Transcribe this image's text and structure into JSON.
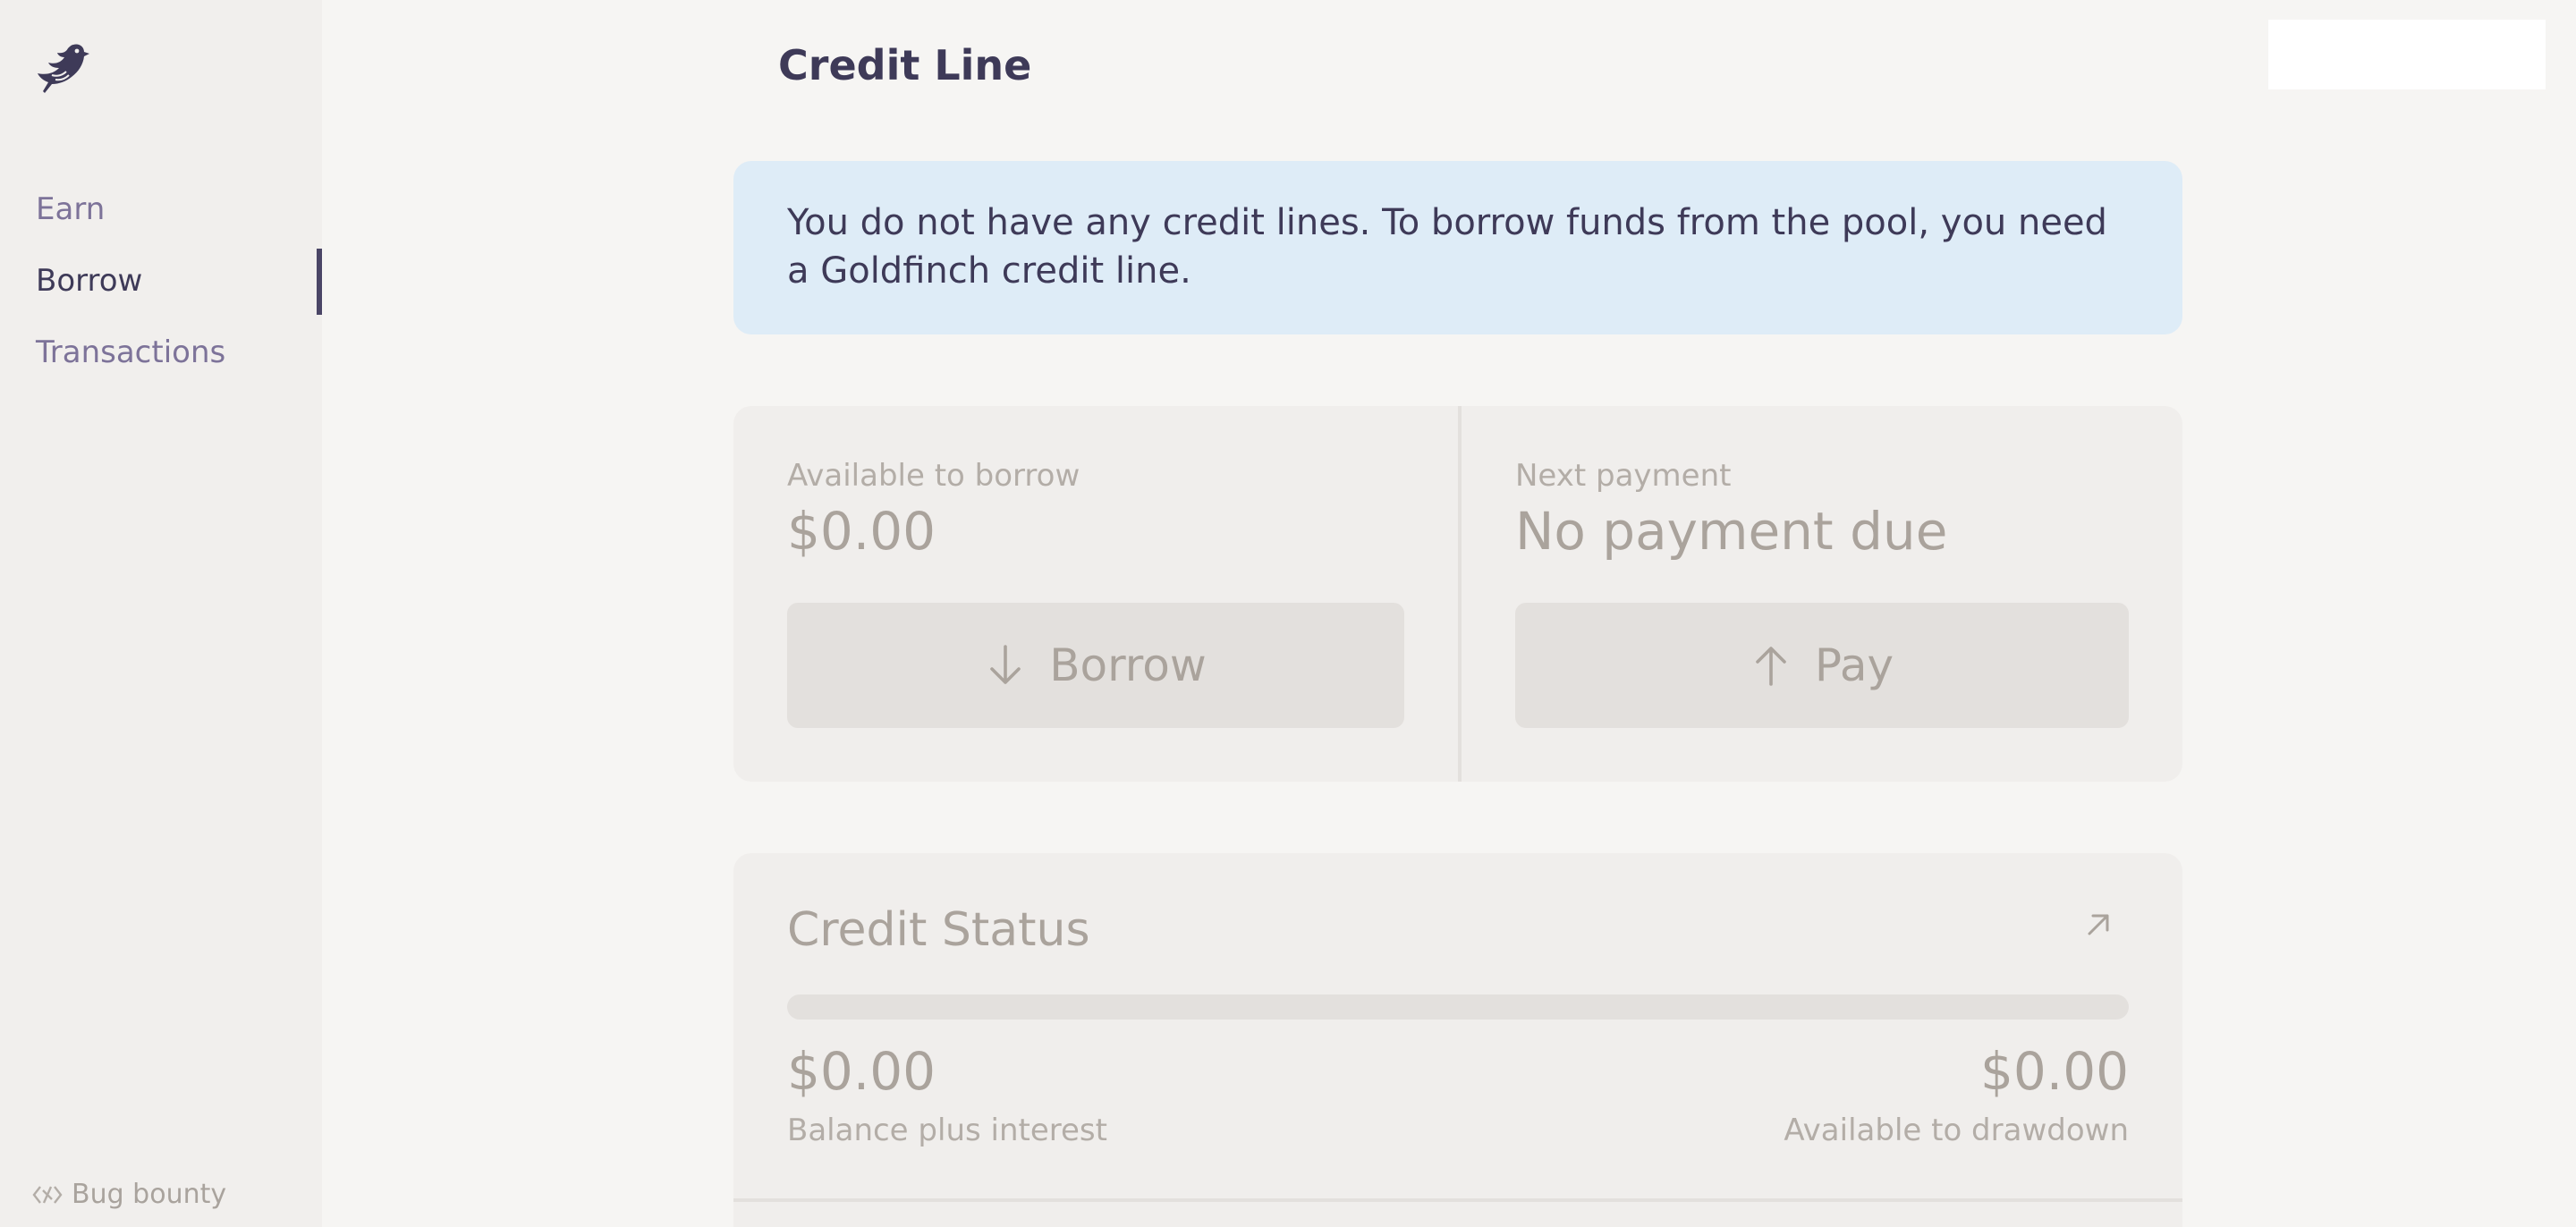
{
  "sidebar": {
    "logo_icon": "goldfinch-bird-logo",
    "items": [
      {
        "label": "Earn",
        "active": false
      },
      {
        "label": "Borrow",
        "active": true
      },
      {
        "label": "Transactions",
        "active": false
      }
    ],
    "footer_link": {
      "label": "Bug bounty",
      "icon": "bug-bounty-icon"
    }
  },
  "header": {
    "title": "Credit Line"
  },
  "banner": {
    "message": "You do not have any credit lines. To borrow funds from the pool, you need a Goldfinch credit line."
  },
  "actions": {
    "borrow": {
      "label": "Available to borrow",
      "value": "$0.00",
      "button_label": "Borrow",
      "button_icon": "arrow-down-icon"
    },
    "pay": {
      "label": "Next payment",
      "value": "No payment due",
      "button_label": "Pay",
      "button_icon": "arrow-up-icon"
    }
  },
  "credit_status": {
    "title": "Credit Status",
    "expand_icon": "arrow-up-right-icon",
    "progress": 0,
    "balance": {
      "value": "$0.00",
      "label": "Balance plus interest"
    },
    "available": {
      "value": "$0.00",
      "label": "Available to drawdown"
    }
  },
  "colors": {
    "accent": "#3e3a58",
    "nav_inactive": "#7d7399",
    "banner_bg": "#deecf7",
    "panel_bg": "#f0eeec",
    "disabled_text": "#aaa39c"
  }
}
